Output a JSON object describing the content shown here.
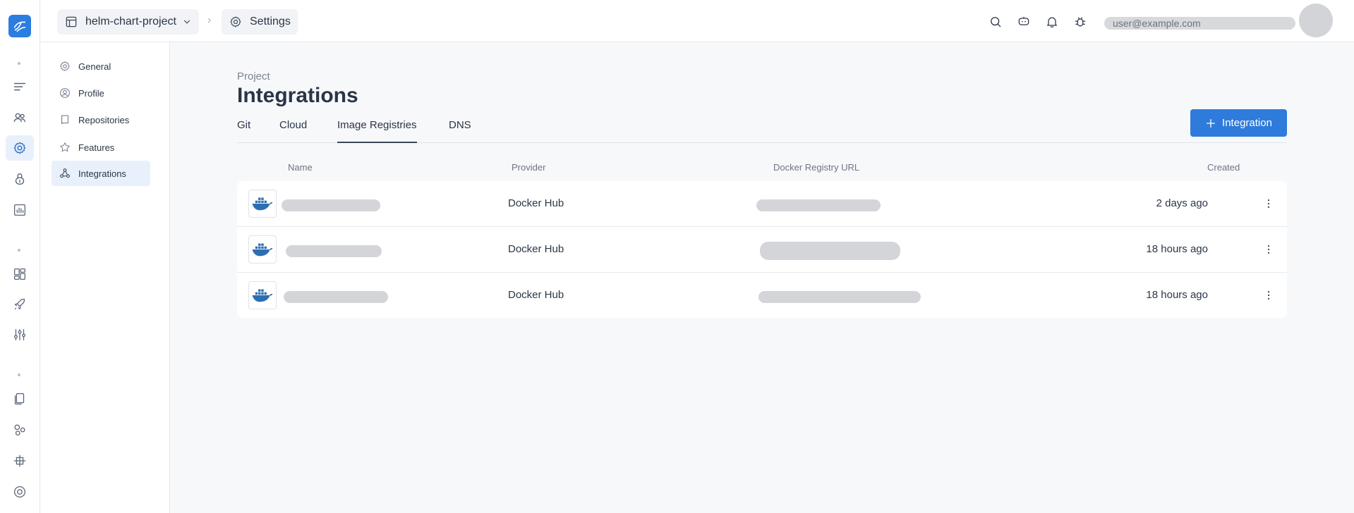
{
  "header": {
    "project": "helm-chart-project",
    "section": "Settings",
    "user": "user@example.com"
  },
  "settings_nav": [
    {
      "label": "General",
      "icon": "gear-icon"
    },
    {
      "label": "Profile",
      "icon": "user-circle-icon"
    },
    {
      "label": "Repositories",
      "icon": "book-icon"
    },
    {
      "label": "Features",
      "icon": "star-icon"
    },
    {
      "label": "Integrations",
      "icon": "integrations-icon",
      "active": true
    }
  ],
  "page": {
    "eyebrow": "Project",
    "title": "Integrations",
    "add_button": "Integration"
  },
  "tabs": [
    {
      "label": "Git"
    },
    {
      "label": "Cloud"
    },
    {
      "label": "Image Registries",
      "active": true
    },
    {
      "label": "DNS"
    }
  ],
  "table": {
    "columns": {
      "name": "Name",
      "provider": "Provider",
      "url": "Docker Registry URL",
      "created": "Created"
    },
    "rows": [
      {
        "name": "",
        "provider": "Docker Hub",
        "url": "",
        "created": "2 days ago"
      },
      {
        "name": "",
        "provider": "Docker Hub",
        "url": "",
        "created": "18 hours ago"
      },
      {
        "name": "",
        "provider": "Docker Hub",
        "url": "",
        "created": "18 hours ago"
      }
    ]
  },
  "colors": {
    "accent": "#2f7bdb",
    "background": "#f7f8fa"
  }
}
